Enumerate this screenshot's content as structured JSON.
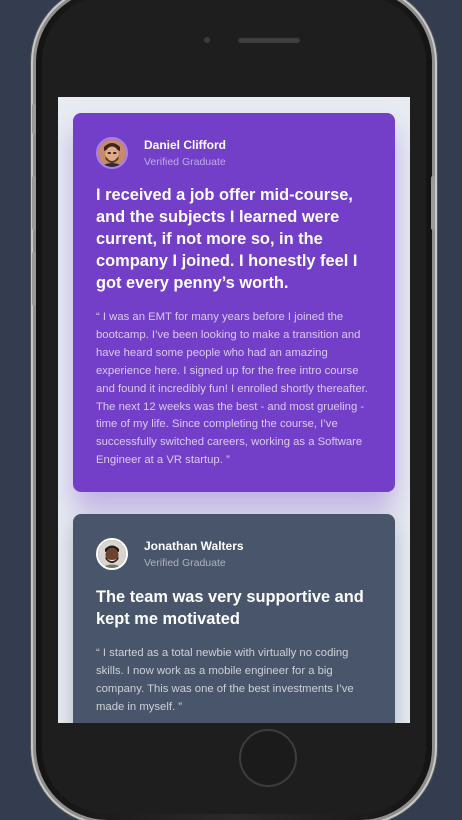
{
  "testimonials": [
    {
      "name": "Daniel Clifford",
      "role": "Verified Graduate",
      "headline": "I received a job offer mid-course, and the subjects I learned were current, if not more so, in the company I joined. I honestly feel I got every penny’s worth.",
      "quote": "“ I was an EMT for many years before I joined the bootcamp. I’ve been looking to make a transition and have heard some people who had an amazing experience here. I signed up for the free intro course and found it incredibly fun! I enrolled shortly thereafter. The next 12 weeks was the best - and most grueling - time of my life. Since completing the course, I’ve successfully switched careers, working as a Software Engineer at a VR startup. ”",
      "card_color": "#733fc8"
    },
    {
      "name": "Jonathan Walters",
      "role": "Verified Graduate",
      "headline": "The team was very supportive and kept me motivated",
      "quote": "“ I started as a total newbie with virtually no coding skills. I now work as a mobile engineer for a big company. This was one of the best investments I’ve made in myself. ”",
      "card_color": "#48556a"
    }
  ],
  "colors": {
    "page_background": "#333d4f",
    "screen_background": "#e8ecf2"
  }
}
